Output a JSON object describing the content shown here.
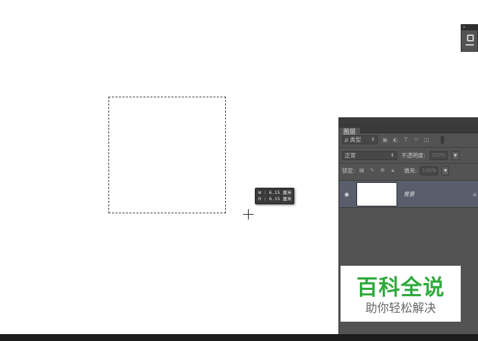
{
  "size_tooltip": {
    "w_line": "W : 6.15 厘米",
    "h_line": "H : 6.15 厘米"
  },
  "layers_panel": {
    "tab_label": "图层",
    "filter_kind": "ρ 类型",
    "filter_arrow": "⇕",
    "filter_icons": [
      "image-filter-icon",
      "adjustment-filter-icon",
      "type-filter-icon",
      "shape-filter-icon",
      "smart-object-filter-icon"
    ],
    "blend_mode": "正常",
    "blend_arrow": "⇕",
    "opacity_label": "不透明度:",
    "opacity_value": "100%",
    "lock_label": "锁定:",
    "fill_label": "填充:",
    "fill_value": "100%",
    "dropdown_glyph": "▼",
    "layers": [
      {
        "name": "背景",
        "visible": true,
        "locked": true
      }
    ]
  },
  "watermark": {
    "title": "百科全说",
    "subtitle": "助你轻松解决"
  },
  "colors": {
    "accent_green": "#2eaa3b",
    "panel_bg": "#535353",
    "selected_layer": "#595e6d"
  }
}
